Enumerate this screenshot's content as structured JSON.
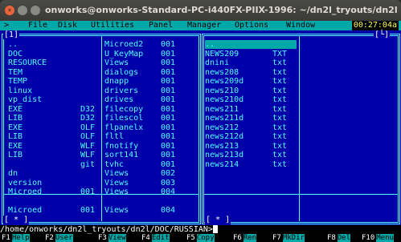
{
  "window": {
    "title": "onworks@onworks-Standard-PC-i440FX-PIIX-1996: ~/dn2l_tryouts/dn2l",
    "close_glyph": "×",
    "minimize_glyph": "",
    "maximize_glyph": ""
  },
  "menubar": {
    "prefix": ">",
    "items": [
      "File",
      "Disk",
      "Utilities",
      "Panel",
      "Manager",
      "Options",
      "Window"
    ],
    "clock": "00:27:04a"
  },
  "left_panel": {
    "title": "[1]",
    "footer": "[ * ]",
    "col1": [
      {
        "name": "..",
        "ext": ""
      },
      {
        "name": "DOC",
        "ext": ""
      },
      {
        "name": "RESOURCE",
        "ext": ""
      },
      {
        "name": "TEM",
        "ext": ""
      },
      {
        "name": "TEMP",
        "ext": ""
      },
      {
        "name": "linux",
        "ext": ""
      },
      {
        "name": "vp_dist",
        "ext": ""
      },
      {
        "name": "EXE",
        "ext": "D32"
      },
      {
        "name": "LIB",
        "ext": "D32"
      },
      {
        "name": "EXE",
        "ext": "OLF"
      },
      {
        "name": "LIB",
        "ext": "OLF"
      },
      {
        "name": "EXE",
        "ext": "WLF"
      },
      {
        "name": "LIB",
        "ext": "WLF"
      },
      {
        "name": "",
        "ext": "git"
      },
      {
        "name": "dn",
        "ext": ""
      },
      {
        "name": "version",
        "ext": ""
      },
      {
        "name": "Microed",
        "ext": "001"
      },
      {
        "name": "",
        "ext": ""
      },
      {
        "name": "Microed",
        "ext": "001"
      }
    ],
    "col2": [
      {
        "name": "Microed2",
        "ext": "001"
      },
      {
        "name": "U_KeyMap",
        "ext": "001"
      },
      {
        "name": "Views",
        "ext": "001"
      },
      {
        "name": "dialogs",
        "ext": "001"
      },
      {
        "name": "dnapp",
        "ext": "001"
      },
      {
        "name": "drivers",
        "ext": "001"
      },
      {
        "name": "drives",
        "ext": "001"
      },
      {
        "name": "filecopy",
        "ext": "001"
      },
      {
        "name": "filescol",
        "ext": "001"
      },
      {
        "name": "flpanelx",
        "ext": "001"
      },
      {
        "name": "fltl",
        "ext": "001"
      },
      {
        "name": "fnotify",
        "ext": "001"
      },
      {
        "name": "sort141",
        "ext": "001"
      },
      {
        "name": "tvhc",
        "ext": "001"
      },
      {
        "name": "Views",
        "ext": "002"
      },
      {
        "name": "Views",
        "ext": "003"
      },
      {
        "name": "Views",
        "ext": "004"
      },
      {
        "name": "",
        "ext": ""
      },
      {
        "name": "Views",
        "ext": "004"
      }
    ]
  },
  "right_panel": {
    "title": "[└]",
    "footer": "[ * ]",
    "col1": [
      {
        "name": "..",
        "ext": ""
      },
      {
        "name": "NEWS209",
        "ext": "TXT"
      },
      {
        "name": "dnini",
        "ext": "txt"
      },
      {
        "name": "news208",
        "ext": "txt"
      },
      {
        "name": "news209d",
        "ext": "txt"
      },
      {
        "name": "news210",
        "ext": "txt"
      },
      {
        "name": "news210d",
        "ext": "txt"
      },
      {
        "name": "news211",
        "ext": "txt"
      },
      {
        "name": "news211d",
        "ext": "txt"
      },
      {
        "name": "news212",
        "ext": "txt"
      },
      {
        "name": "news212d",
        "ext": "txt"
      },
      {
        "name": "news213",
        "ext": "txt"
      },
      {
        "name": "news213d",
        "ext": "txt"
      },
      {
        "name": "news214",
        "ext": "txt"
      }
    ]
  },
  "command_line": {
    "prompt": "/home/onworks/dn2l_tryouts/dn2l/DOC/RUSSIAN>"
  },
  "keybar": [
    {
      "num": "F1",
      "label": "Help"
    },
    {
      "num": "F2",
      "label": "User"
    },
    {
      "num": "F3",
      "label": "View"
    },
    {
      "num": "F4",
      "label": "Edit"
    },
    {
      "num": "F5",
      "label": "Copy"
    },
    {
      "num": "F6",
      "label": "Ren"
    },
    {
      "num": "F7",
      "label": "MkDir"
    },
    {
      "num": "F8",
      "label": "Del"
    },
    {
      "num": "F10",
      "label": "Menu"
    }
  ],
  "colors": {
    "panel_bg": "#0000a8",
    "panel_fg": "#54fefe",
    "menubar_bg": "#00a8a8",
    "cursor_bg": "#00a8a8",
    "clock_fg": "#ffff54"
  }
}
